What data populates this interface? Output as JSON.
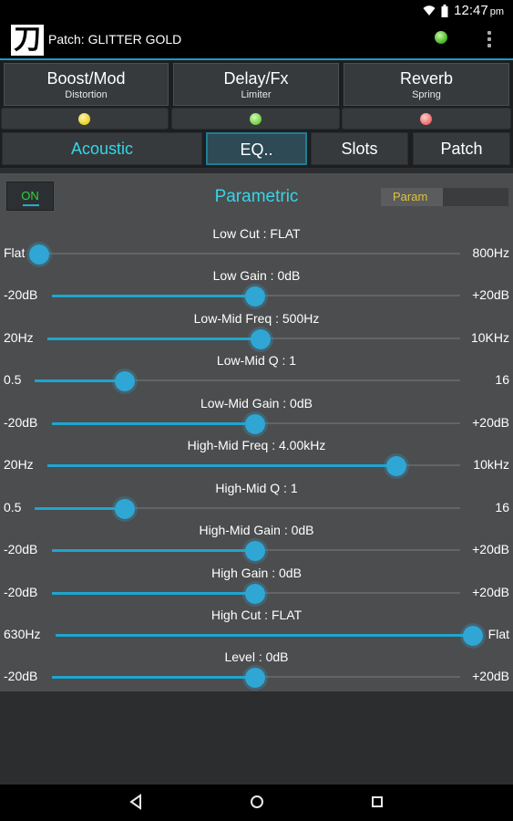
{
  "status_bar": {
    "time": "12:47",
    "ampm": "pm"
  },
  "app_bar": {
    "patch_title": "Patch: GLITTER GOLD",
    "status_led_color": "#3fb41f"
  },
  "fx_blocks": [
    {
      "name": "Boost/Mod",
      "sub": "Distortion",
      "led_color": "#e8d21e"
    },
    {
      "name": "Delay/Fx",
      "sub": "Limiter",
      "led_color": "#6fcf3a"
    },
    {
      "name": "Reverb",
      "sub": "Spring",
      "led_color": "#f06a6a"
    }
  ],
  "tabs": [
    {
      "label": "Acoustic"
    },
    {
      "label": "EQ.."
    },
    {
      "label": "Slots"
    },
    {
      "label": "Patch"
    }
  ],
  "eq_panel": {
    "on_label": "ON",
    "title": "Parametric",
    "mode_label": "Param",
    "params": [
      {
        "label": "Low Cut : FLAT",
        "min": "Flat",
        "max": "800Hz",
        "value": 0.0
      },
      {
        "label": "Low Gain : 0dB",
        "min": "-20dB",
        "max": "+20dB",
        "value": 0.5
      },
      {
        "label": "Low-Mid Freq : 500Hz",
        "min": "20Hz",
        "max": "10KHz",
        "value": 0.51
      },
      {
        "label": "Low-Mid Q : 1",
        "min": "0.5",
        "max": "16",
        "value": 0.21
      },
      {
        "label": "Low-Mid Gain : 0dB",
        "min": "-20dB",
        "max": "+20dB",
        "value": 0.5
      },
      {
        "label": "High-Mid Freq : 4.00kHz",
        "min": "20Hz",
        "max": "10kHz",
        "value": 0.84
      },
      {
        "label": "High-Mid Q : 1",
        "min": "0.5",
        "max": "16",
        "value": 0.21
      },
      {
        "label": "High-Mid Gain : 0dB",
        "min": "-20dB",
        "max": "+20dB",
        "value": 0.5
      },
      {
        "label": "High Gain : 0dB",
        "min": "-20dB",
        "max": "+20dB",
        "value": 0.5
      },
      {
        "label": "High Cut : FLAT",
        "min": "630Hz",
        "max": "Flat",
        "value": 1.0
      },
      {
        "label": "Level : 0dB",
        "min": "-20dB",
        "max": "+20dB",
        "value": 0.5
      }
    ]
  },
  "nav_bar": {
    "back_icon": "back-triangle-icon",
    "home_icon": "home-circle-icon",
    "recents_icon": "recents-square-icon"
  }
}
